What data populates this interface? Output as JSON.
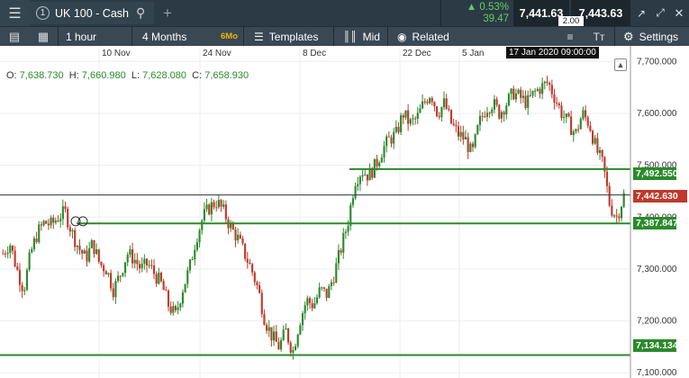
{
  "topbar": {
    "instrument_number": "1",
    "instrument_name": "UK 100 - Cash",
    "change_pct": "0.53%",
    "change_abs": "39.47",
    "sell_price": "7,441.63",
    "buy_price": "7,443.63",
    "spread": "2.00"
  },
  "toolbar": {
    "interval": "1 hour",
    "range": "4 Months",
    "range_badge": "6Mo",
    "templates": "Templates",
    "price_mode": "Mid",
    "related": "Related",
    "settings": "Settings"
  },
  "chart": {
    "crosshair_date": "17 Jan 2020 09:00:00",
    "ohlc": {
      "o": "7,638.730",
      "h": "7,660.980",
      "l": "7,628.080",
      "c": "7,658.930"
    },
    "date_ticks": [
      "10 Nov",
      "24 Nov",
      "8 Dec",
      "22 Dec",
      "5 Jan"
    ],
    "price_ticks": [
      "7,700.000",
      "7,600.000",
      "7,500.000",
      "7,400.000",
      "7,300.000",
      "7,200.000",
      "7,100.000"
    ],
    "horizontal_levels": [
      "7,492.550",
      "7,387.847",
      "7,134.134"
    ],
    "current_price": "7,442.630",
    "colors": {
      "up": "#2a8a2a",
      "down": "#c0392b",
      "level": "#2a8a2a",
      "current": "#c0392b"
    }
  },
  "chart_data": {
    "type": "candlestick",
    "title": "",
    "y_range": [
      7090,
      7730
    ],
    "x_labels": [
      "10 Nov",
      "24 Nov",
      "8 Dec",
      "22 Dec",
      "5 Jan"
    ],
    "horizontal_lines": [
      7492.55,
      7387.847,
      7134.134
    ],
    "last_price": 7442.63,
    "close_path": [
      7330,
      7350,
      7300,
      7260,
      7330,
      7370,
      7390,
      7385,
      7400,
      7410,
      7370,
      7340,
      7320,
      7350,
      7310,
      7300,
      7260,
      7290,
      7330,
      7320,
      7300,
      7310,
      7290,
      7270,
      7230,
      7210,
      7260,
      7300,
      7360,
      7400,
      7420,
      7430,
      7410,
      7380,
      7360,
      7330,
      7300,
      7260,
      7200,
      7170,
      7150,
      7180,
      7140,
      7200,
      7240,
      7230,
      7260,
      7250,
      7290,
      7340,
      7390,
      7470,
      7490,
      7480,
      7500,
      7530,
      7550,
      7560,
      7600,
      7580,
      7590,
      7620,
      7640,
      7600,
      7620,
      7580,
      7560,
      7550,
      7520,
      7580,
      7610,
      7620,
      7600,
      7620,
      7640,
      7630,
      7620,
      7640,
      7650,
      7660,
      7630,
      7600,
      7580,
      7560,
      7600,
      7580,
      7530,
      7500,
      7420,
      7400,
      7442
    ]
  }
}
